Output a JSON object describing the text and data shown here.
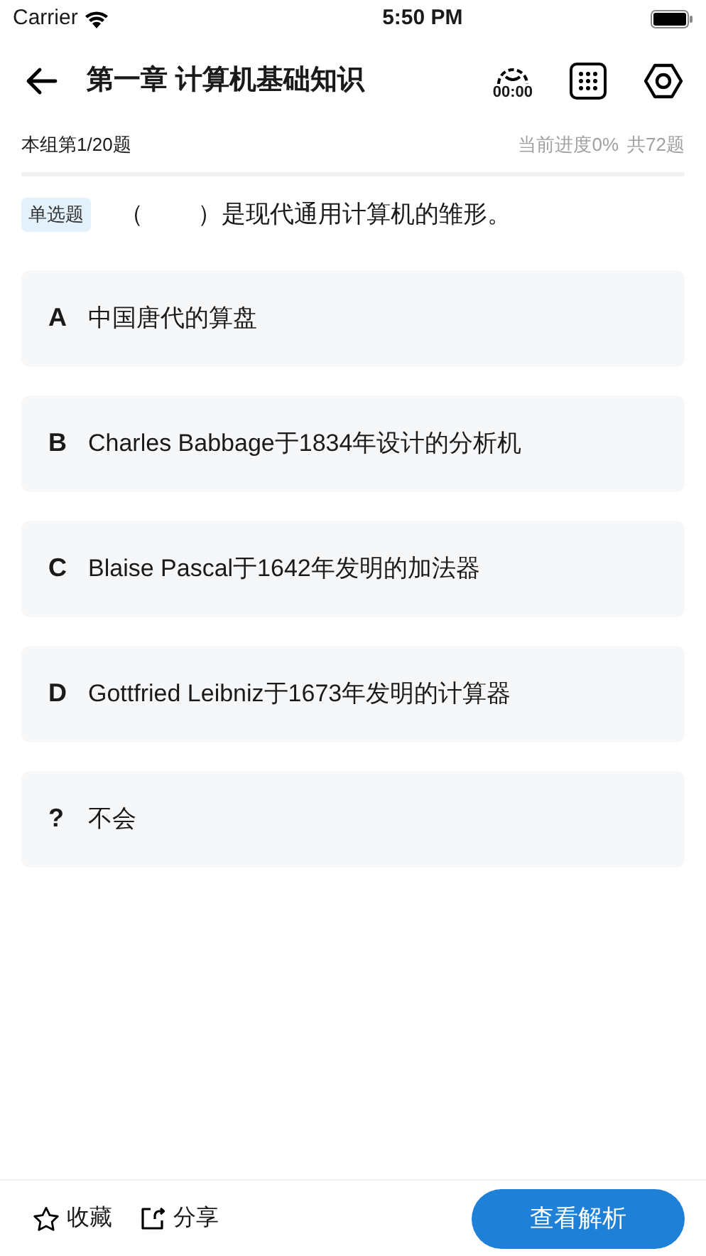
{
  "status_bar": {
    "carrier": "Carrier",
    "time": "5:50 PM"
  },
  "header": {
    "title": "第一章 计算机基础知识",
    "timer": "00:00"
  },
  "progress": {
    "group_label": "本组第1/20题",
    "current": "当前进度0%",
    "total": "共72题"
  },
  "question": {
    "type_tag": "单选题",
    "text": "（        ）是现代通用计算机的雏形。"
  },
  "options": [
    {
      "letter": "A",
      "text": "中国唐代的算盘"
    },
    {
      "letter": "B",
      "text": "Charles Babbage于1834年设计的分析机"
    },
    {
      "letter": "C",
      "text": "Blaise Pascal于1642年发明的加法器"
    },
    {
      "letter": "D",
      "text": "Gottfried Leibniz于1673年发明的计算器"
    },
    {
      "letter": "?",
      "text": "不会"
    }
  ],
  "bottom_bar": {
    "favorite": "收藏",
    "share": "分享",
    "analysis_button": "查看解析"
  }
}
